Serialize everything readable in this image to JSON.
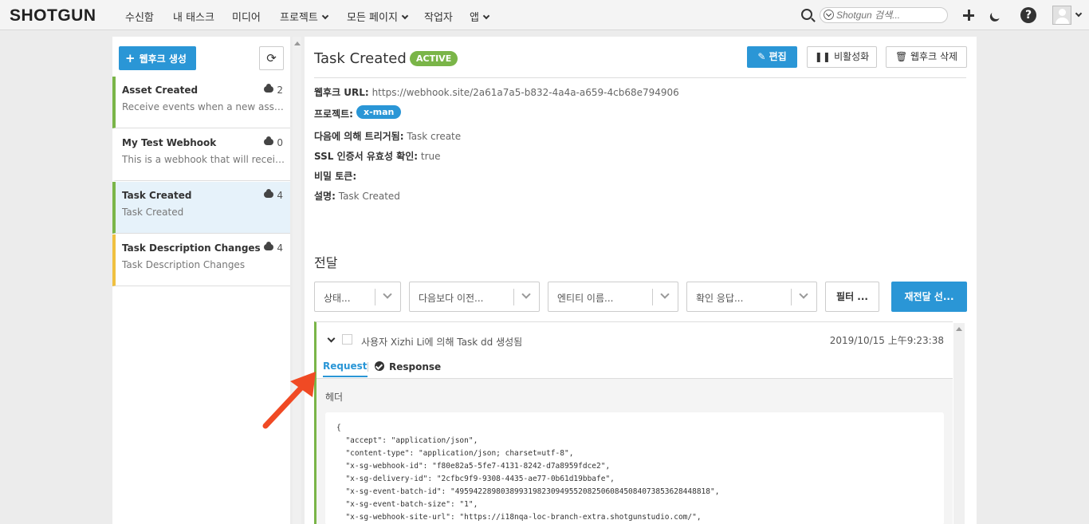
{
  "app": {
    "logo": "SHOTGUN"
  },
  "nav": {
    "items": [
      "수신함",
      "내 태스크",
      "미디어",
      "프로젝트",
      "모든 페이지",
      "작업자",
      "앱"
    ],
    "search_placeholder": "Shotgun 검색...",
    "help": "?"
  },
  "sidebar": {
    "create_button": "웹후크 생성",
    "create_icon": "+",
    "refresh_icon": "⟳",
    "items": [
      {
        "title": "Asset Created",
        "desc": "Receive events when a new asset is created",
        "count": "2",
        "color": "#7ab548"
      },
      {
        "title": "My Test Webhook",
        "desc": "This is a webhook that will receive events",
        "count": "0",
        "color": "transparent"
      },
      {
        "title": "Task Created",
        "desc": "Task Created",
        "count": "4",
        "color": "#7ab548"
      },
      {
        "title": "Task Description Changes",
        "desc": "Task Description Changes",
        "count": "4",
        "color": "#f0c040"
      }
    ]
  },
  "main": {
    "title": "Task Created",
    "status": "ACTIVE",
    "buttons": {
      "edit": "편집",
      "deactivate": "비활성화",
      "delete": "웹후크 삭제"
    },
    "fields": {
      "url_label": "웹후크 URL:",
      "url_value": "https://webhook.site/2a61a7a5-b832-4a4a-a659-4cb68e794906",
      "project_label": "프로젝트:",
      "project_value": "x-man",
      "trigger_label": "다음에 의해 트리거됨:",
      "trigger_value": "Task create",
      "ssl_label": "SSL 인증서 유효성 확인:",
      "ssl_value": "true",
      "secret_label": "비밀 토큰:",
      "desc_label": "설명:",
      "desc_value": "Task Created"
    },
    "deliveries_title": "전달",
    "filters": [
      "상태...",
      "다음보다 이전...",
      "엔티티 이름...",
      "확인 응답..."
    ],
    "filter_button": "필터 ...",
    "redeliver_button": "재전달 선...",
    "delivery": {
      "summary": "사용자 Xizhi Li에 의해 Task dd 생성됨",
      "timestamp": "2019/10/15 上午9:23:38",
      "tab_request": "Request",
      "tab_response": "Response",
      "headers_label": "헤더",
      "code_lines": [
        "{",
        "  \"accept\": \"application/json\",",
        "  \"content-type\": \"application/json; charset=utf-8\",",
        "  \"x-sg-webhook-id\": \"f80e82a5-5fe7-4131-8242-d7a8959fdce2\",",
        "  \"x-sg-delivery-id\": \"2cfbc9f9-9308-4435-ae77-0b61d19bbafe\",",
        "  \"x-sg-event-batch-id\": \"49594228980389931982309495520825060845084073853628448818\",",
        "  \"x-sg-event-batch-size\": \"1\",",
        "  \"x-sg-webhook-site-url\": \"https://i18nqa-loc-branch-extra.shotgunstudio.com/\","
      ]
    }
  },
  "colors": {
    "accent": "#2a96d6",
    "active": "#7ab548",
    "annotation": "#f04a24"
  }
}
